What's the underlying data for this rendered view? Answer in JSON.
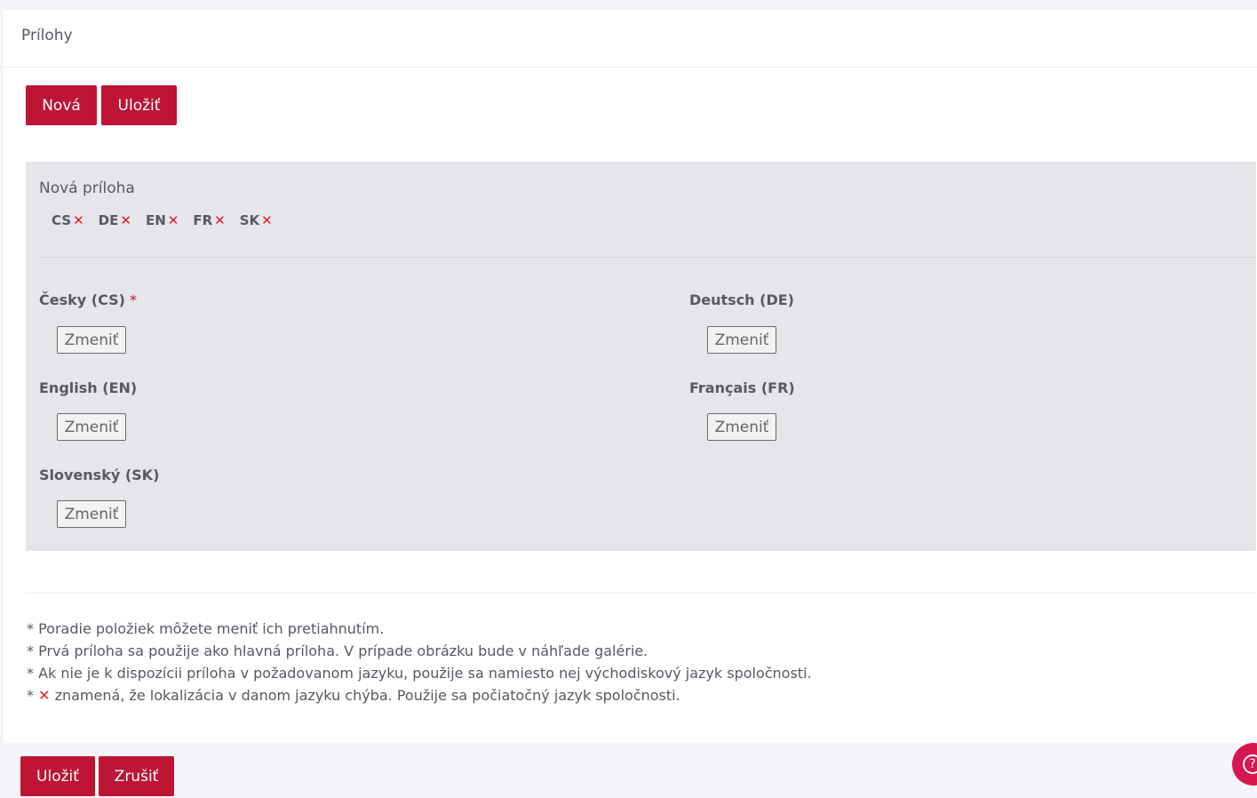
{
  "card": {
    "title": "Prílohy"
  },
  "toolbar": {
    "new_label": "Nová",
    "save_label": "Uložiť"
  },
  "attachment": {
    "title": "Nová príloha",
    "lang_tags": [
      {
        "code": "CS",
        "missing_mark": "✕"
      },
      {
        "code": "DE",
        "missing_mark": "✕"
      },
      {
        "code": "EN",
        "missing_mark": "✕"
      },
      {
        "code": "FR",
        "missing_mark": "✕"
      },
      {
        "code": "SK",
        "missing_mark": "✕"
      }
    ],
    "fields": [
      {
        "label": "Česky (CS)",
        "required_mark": "*",
        "button": "Zmeniť"
      },
      {
        "label": "Deutsch (DE)",
        "button": "Zmeniť"
      },
      {
        "label": "English (EN)",
        "button": "Zmeniť"
      },
      {
        "label": "Français (FR)",
        "button": "Zmeniť"
      },
      {
        "label": "Slovenský (SK)",
        "button": "Zmeniť"
      }
    ]
  },
  "notes": {
    "line1": "* Poradie položiek môžete meniť ich pretiahnutím.",
    "line2": "* Prvá príloha sa použije ako hlavná príloha. V prípade obrázku bude v náhľade galérie.",
    "line3": "* Ak nie je k dispozícii príloha v požadovanom jazyku, použije sa namiesto nej východiskový jazyk spoločnosti.",
    "line4_prefix": "* ",
    "line4_mark": "✕",
    "line4_text": " znamená, že lokalizácia v danom jazyku chýba. Použije sa počiatočný jazyk spoločnosti."
  },
  "footer": {
    "save_label": "Uložiť",
    "cancel_label": "Zrušiť",
    "help_icon": "?"
  },
  "colors": {
    "primary": "#be1535",
    "missing": "#e11d2b",
    "panel": "#e5e5ea"
  }
}
